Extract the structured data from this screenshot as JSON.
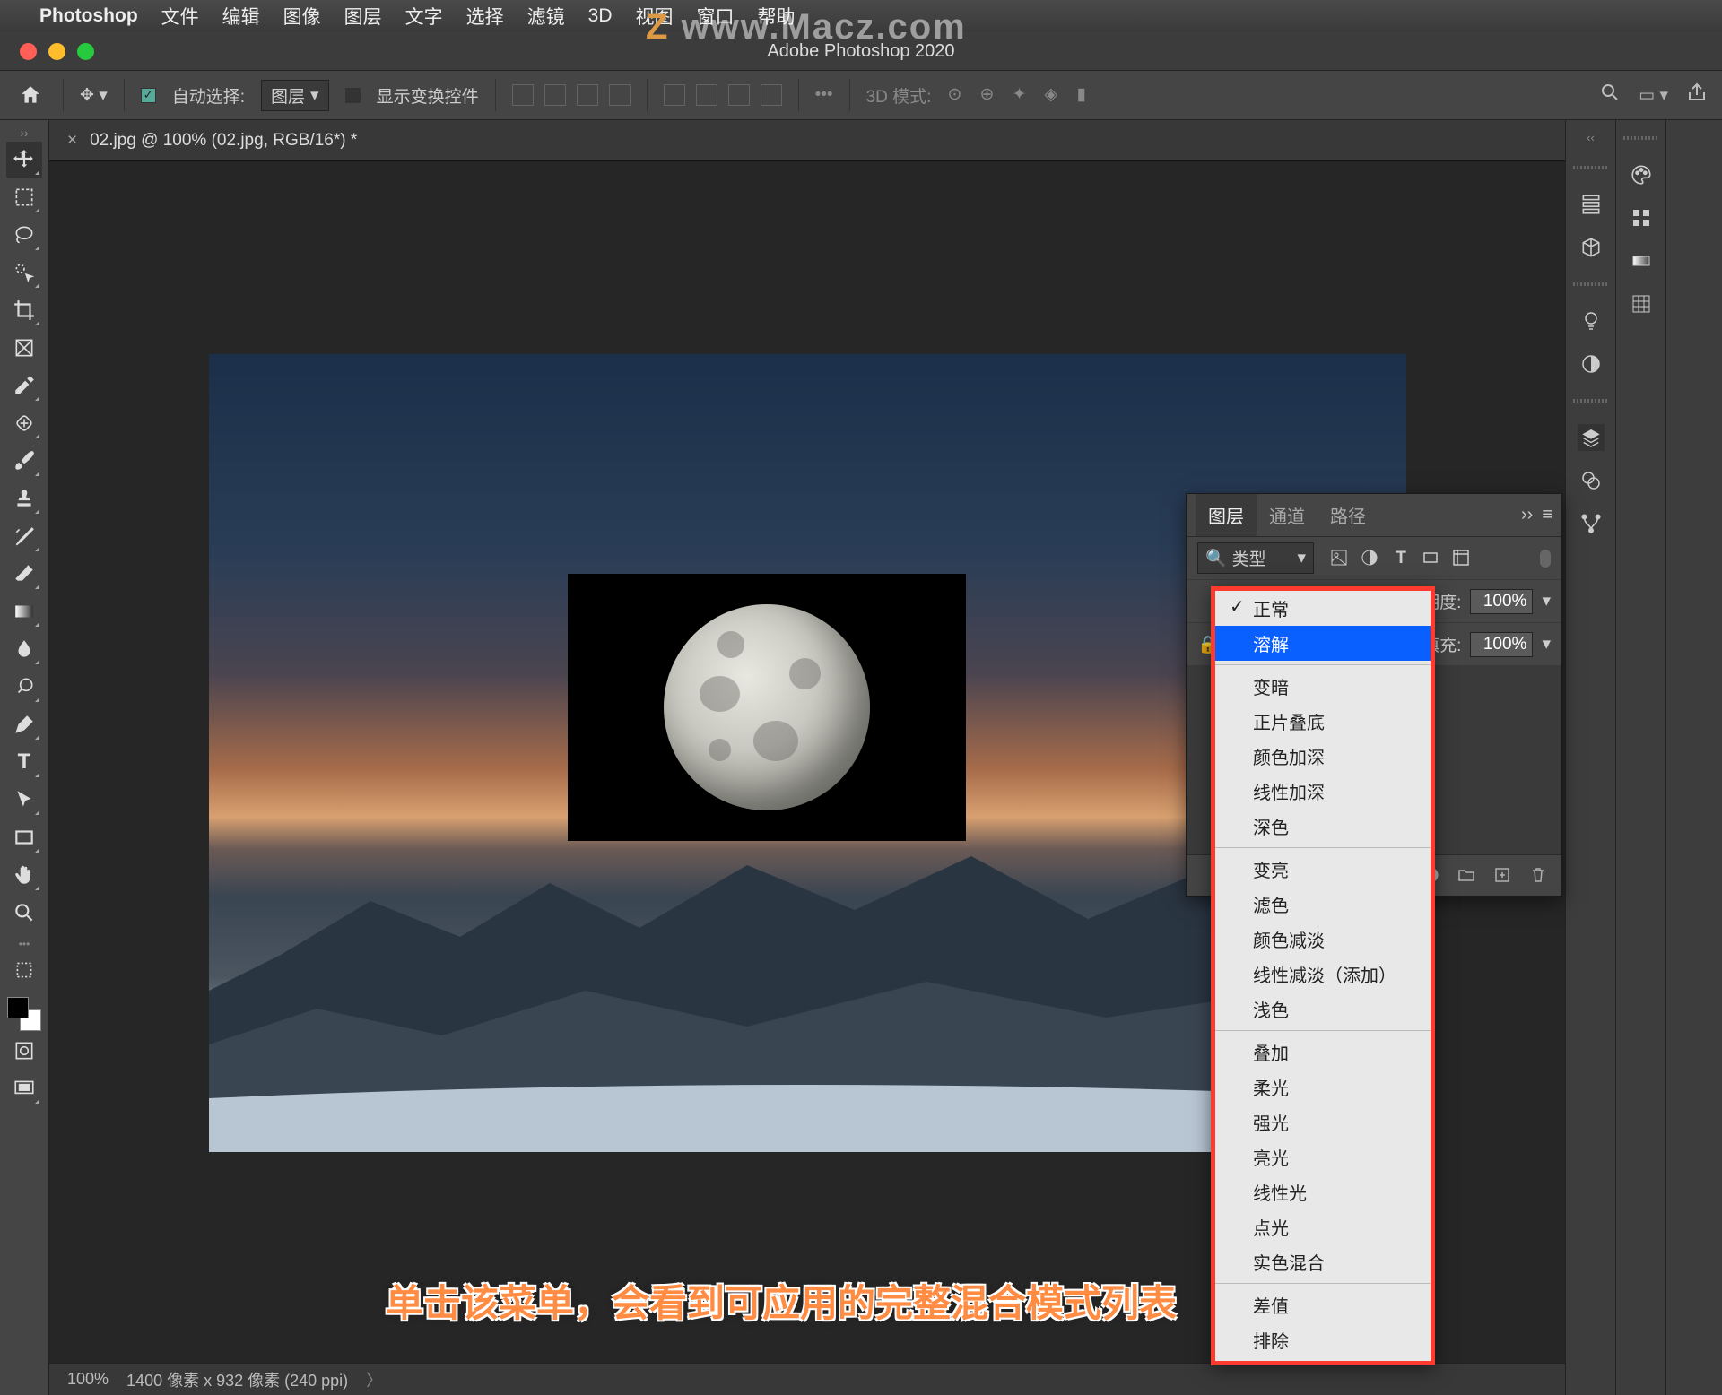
{
  "mac_menu": {
    "app": "Photoshop",
    "items": [
      "文件",
      "编辑",
      "图像",
      "图层",
      "文字",
      "选择",
      "滤镜",
      "3D",
      "视图",
      "窗口",
      "帮助"
    ]
  },
  "watermark": "www.Macz.com",
  "window_title": "Adobe Photoshop 2020",
  "options_bar": {
    "auto_select": "自动选择:",
    "target": "图层",
    "show_transform": "显示变换控件",
    "mode_3d": "3D 模式:"
  },
  "doc_tab": "02.jpg @ 100% (02.jpg, RGB/16*) *",
  "status": {
    "zoom": "100%",
    "info": "1400 像素 x 932 像素 (240 ppi)"
  },
  "layers_panel": {
    "tabs": [
      "图层",
      "通道",
      "路径"
    ],
    "kind": "类型",
    "opacity_label": "透明度:",
    "opacity_value": "100%",
    "fill_label": "填充:",
    "fill_value": "100%"
  },
  "blend_modes": {
    "groups": [
      [
        "正常",
        "溶解"
      ],
      [
        "变暗",
        "正片叠底",
        "颜色加深",
        "线性加深",
        "深色"
      ],
      [
        "变亮",
        "滤色",
        "颜色减淡",
        "线性减淡（添加）",
        "浅色"
      ],
      [
        "叠加",
        "柔光",
        "强光",
        "亮光",
        "线性光",
        "点光",
        "实色混合"
      ],
      [
        "差值",
        "排除"
      ]
    ],
    "checked": "正常",
    "selected": "溶解"
  },
  "caption": "单击该菜单，会看到可应用的完整混合模式列表"
}
